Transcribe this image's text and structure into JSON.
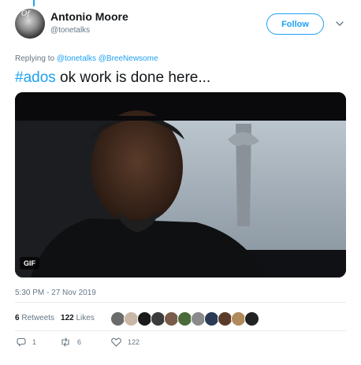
{
  "author": {
    "display_name": "Antonio Moore",
    "handle": "@tonetalks",
    "avatar_text": "Of"
  },
  "follow_label": "Follow",
  "reply": {
    "prefix": "Replying to",
    "mentions": [
      "@tonetalks",
      "@BreeNewsome"
    ]
  },
  "tweet": {
    "hashtag": "#ados",
    "text": " ok work is done here..."
  },
  "media": {
    "badge": "GIF"
  },
  "timestamp": "5:30 PM - 27 Nov 2019",
  "stats": {
    "retweets_count": "6",
    "retweets_label": "Retweets",
    "likes_count": "122",
    "likes_label": "Likes"
  },
  "likers": {
    "colors": [
      "#6b6b6b",
      "#c9b7a6",
      "#1a1a1a",
      "#3b3b3b",
      "#7a5c4a",
      "#4a6a3a",
      "#8a8a8a",
      "#2b3a55",
      "#5a3b2a",
      "#b08a5a",
      "#222222"
    ]
  },
  "actions": {
    "reply_count": "1",
    "retweet_count": "6",
    "like_count": "122"
  },
  "colors": {
    "accent": "#1da1f2",
    "muted": "#657786",
    "text": "#14171a"
  }
}
